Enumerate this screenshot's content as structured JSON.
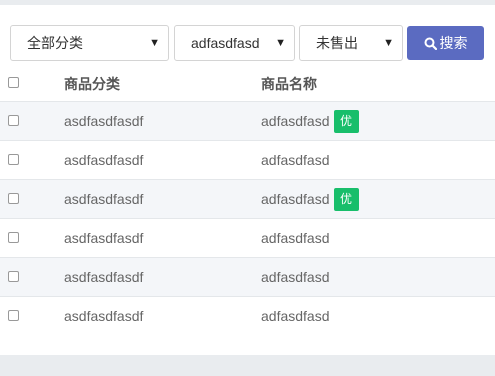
{
  "filters": {
    "category_select": "全部分类",
    "product_select": "adfasdfasd",
    "status_select": "未售出",
    "search_button": "搜索"
  },
  "table": {
    "columns": [
      "商品分类",
      "商品名称"
    ],
    "rows": [
      {
        "category": "asdfasdfasdf",
        "name": "adfasdfasd",
        "badge": "优"
      },
      {
        "category": "asdfasdfasdf",
        "name": "adfasdfasd",
        "badge": ""
      },
      {
        "category": "asdfasdfasdf",
        "name": "adfasdfasd",
        "badge": "优"
      },
      {
        "category": "asdfasdfasdf",
        "name": "adfasdfasd",
        "badge": ""
      },
      {
        "category": "asdfasdfasdf",
        "name": "adfasdfasd",
        "badge": ""
      },
      {
        "category": "asdfasdfasdf",
        "name": "adfasdfasd",
        "badge": ""
      }
    ]
  },
  "colors": {
    "accent": "#5b6bc1",
    "badge": "#18be6b"
  }
}
